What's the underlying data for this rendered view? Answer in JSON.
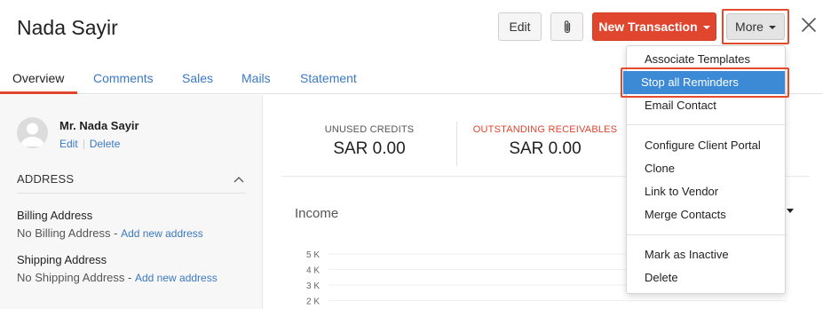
{
  "header": {
    "title": "Nada Sayir",
    "edit_label": "Edit",
    "new_transaction_label": "New Transaction",
    "more_label": "More"
  },
  "tabs": [
    {
      "label": "Overview"
    },
    {
      "label": "Comments"
    },
    {
      "label": "Sales"
    },
    {
      "label": "Mails"
    },
    {
      "label": "Statement"
    }
  ],
  "sidebar": {
    "contact_name": "Mr. Nada Sayir",
    "edit_link": "Edit",
    "delete_link": "Delete",
    "address_section": "ADDRESS",
    "billing": {
      "label": "Billing Address",
      "value": "No Billing Address",
      "dash": " - ",
      "link": "Add new address"
    },
    "shipping": {
      "label": "Shipping Address",
      "value": "No Shipping Address",
      "dash": " - ",
      "link": "Add new address"
    }
  },
  "summary": {
    "unused_credits_label": "UNUSED CREDITS",
    "unused_credits_value": "SAR 0.00",
    "outstanding_label": "OUTSTANDING RECEIVABLES",
    "outstanding_value": "SAR 0.00"
  },
  "income": {
    "title": "Income",
    "y_ticks": [
      "5 K",
      "4 K",
      "3 K",
      "2 K"
    ]
  },
  "more_menu": {
    "items": [
      "Associate Templates",
      "Stop all Reminders",
      "Email Contact",
      "Configure Client Portal",
      "Clone",
      "Link to Vendor",
      "Merge Contacts",
      "Mark as Inactive",
      "Delete"
    ],
    "highlighted": "Stop all Reminders"
  },
  "colors": {
    "accent": "#e0452e",
    "link": "#3b79c3",
    "highlight": "#3c8ad6",
    "annotation": "#e34b2b"
  },
  "icons": [
    "paperclip-icon",
    "close-icon",
    "avatar-icon",
    "chevron-up-icon",
    "caret-down-icon"
  ]
}
